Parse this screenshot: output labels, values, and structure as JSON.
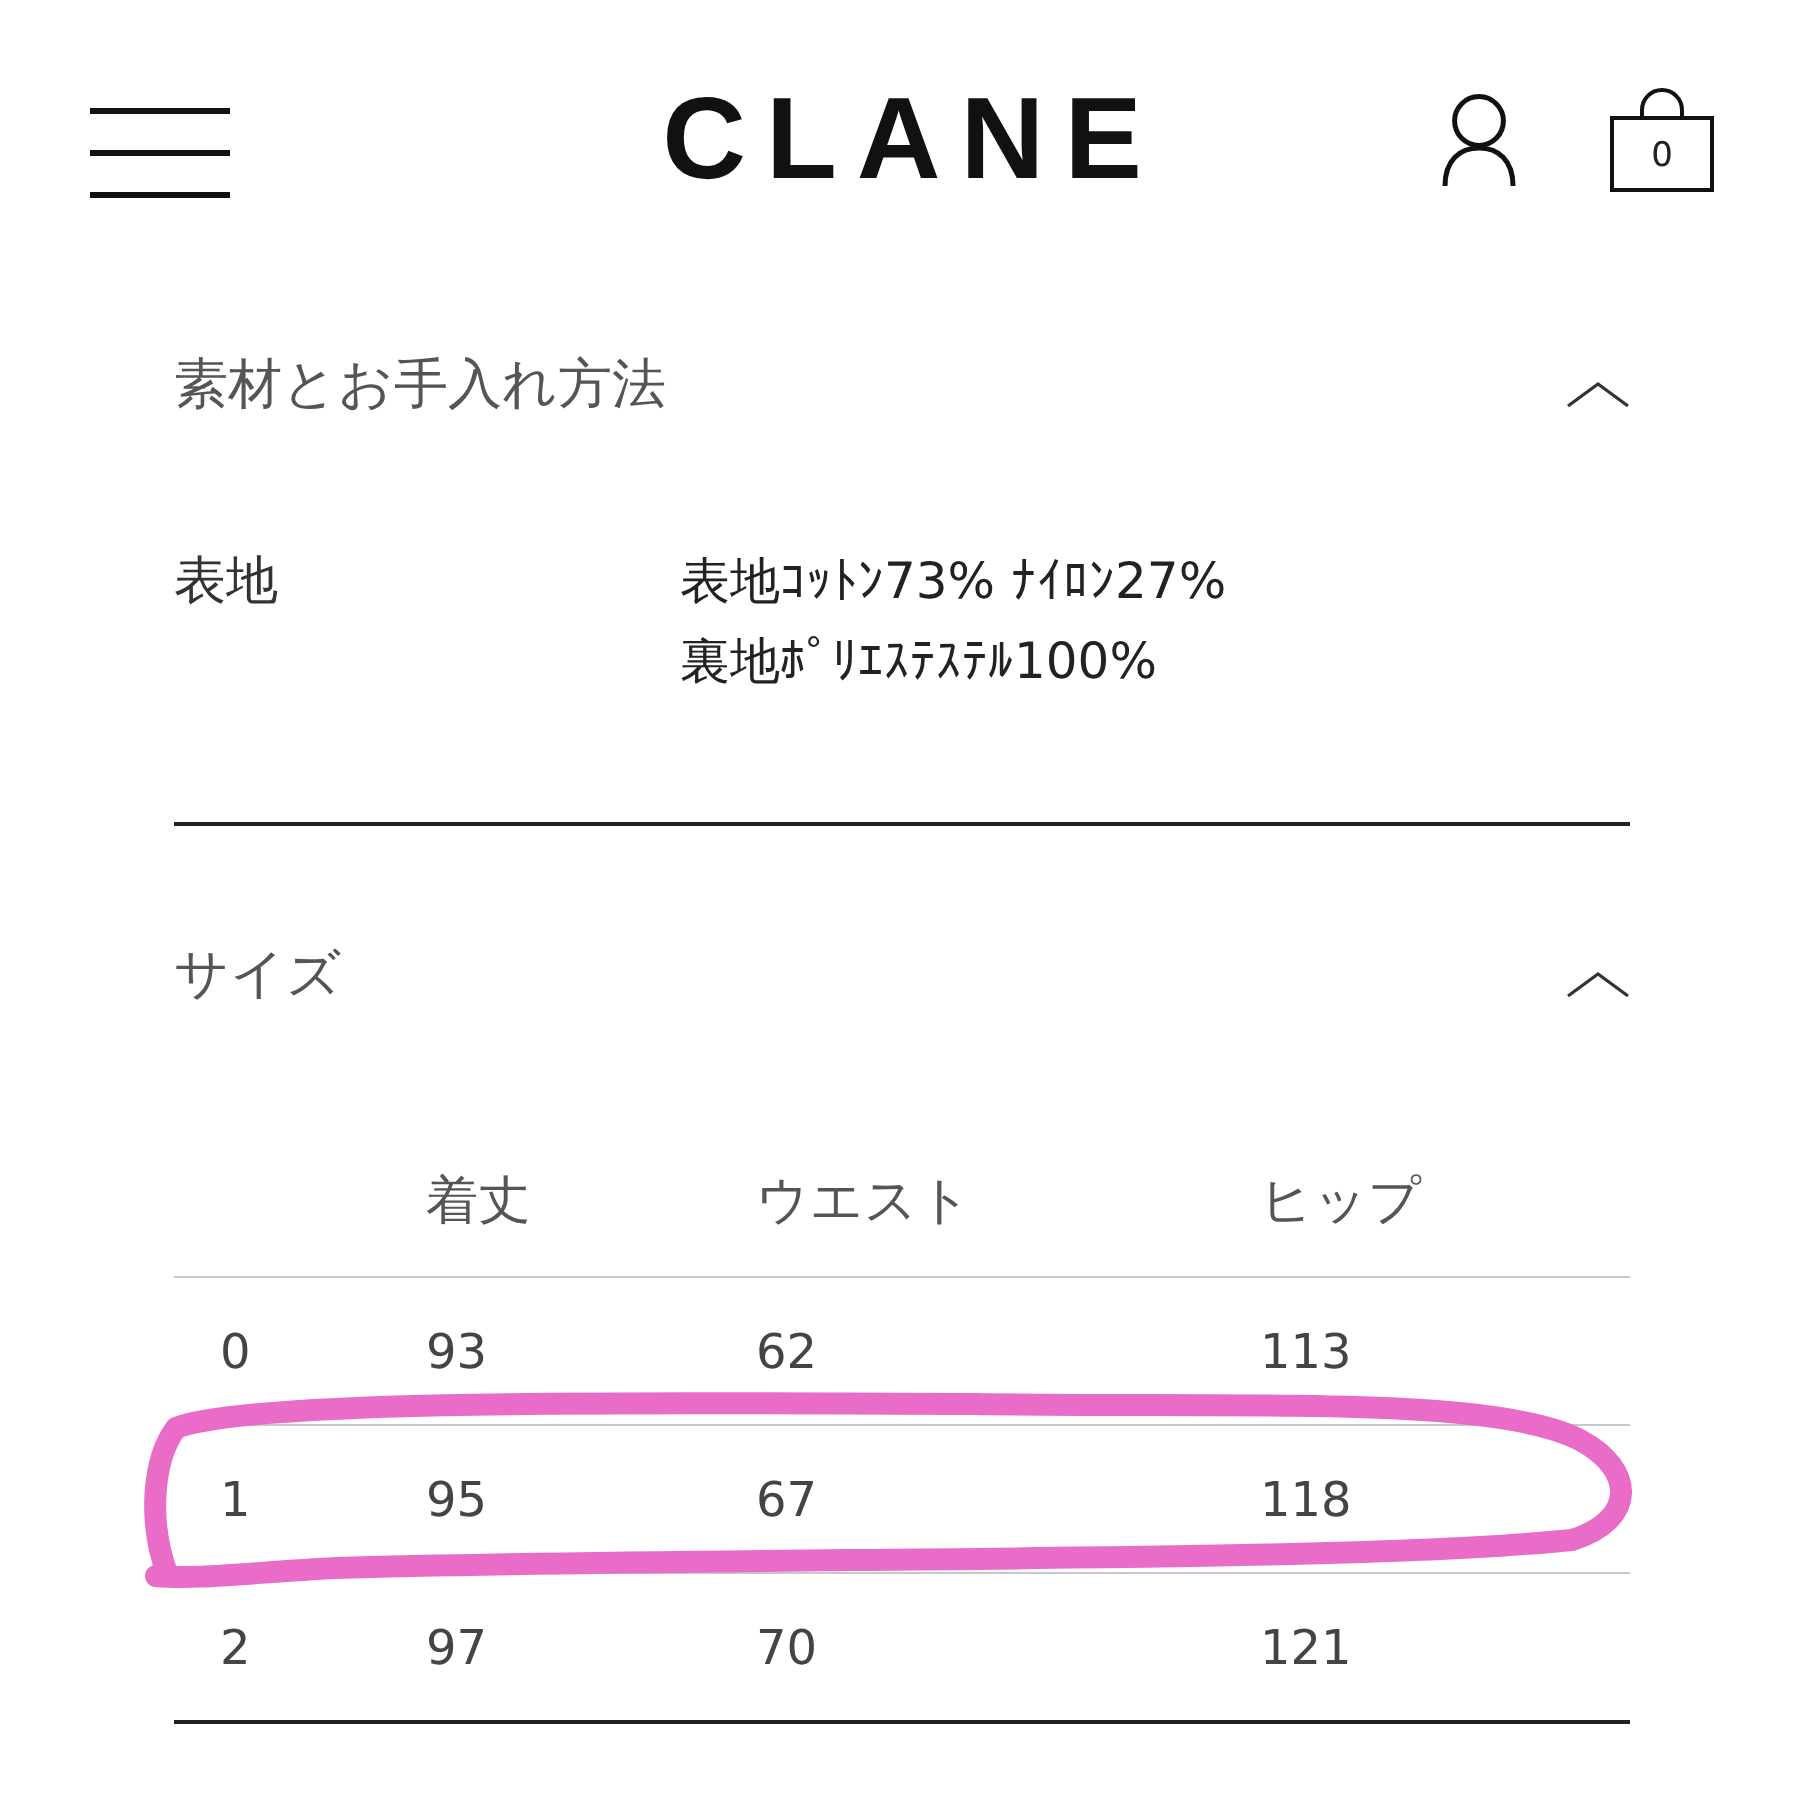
{
  "header": {
    "logo": "CLANE",
    "cart_count": "0"
  },
  "sections": [
    {
      "kind": "details",
      "title": "素材とお手入れ方法",
      "expanded": true,
      "rows": [
        {
          "label": "表地",
          "lines": [
            "表地ｺｯﾄﾝ73% ﾅｲﾛﾝ27%",
            "裏地ﾎﾟﾘｴｽﾃｽﾃﾙ100%"
          ]
        }
      ]
    },
    {
      "kind": "size_table",
      "title": "サイズ",
      "expanded": true,
      "table": {
        "columns": [
          "",
          "着丈",
          "ウエスト",
          "ヒップ"
        ],
        "rows": [
          {
            "cells": [
              "0",
              "93",
              "62",
              "113"
            ],
            "circled": false
          },
          {
            "cells": [
              "1",
              "95",
              "67",
              "118"
            ],
            "circled": true
          },
          {
            "cells": [
              "2",
              "97",
              "70",
              "121"
            ],
            "circled": false
          }
        ]
      }
    }
  ]
}
